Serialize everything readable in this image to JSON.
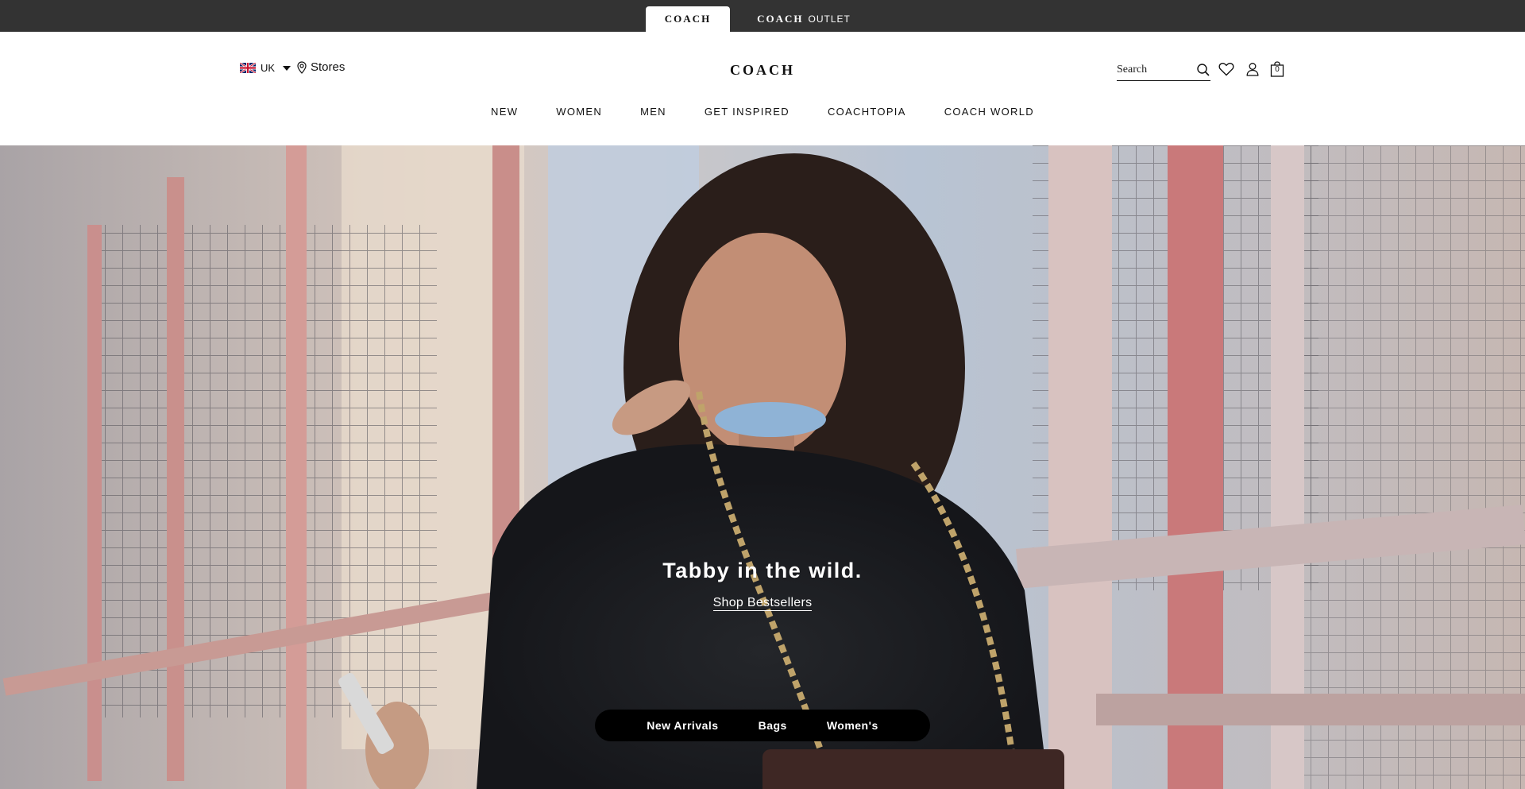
{
  "brandbar": {
    "tabs": [
      {
        "label": "COACH",
        "active": true
      },
      {
        "label": "COACH",
        "suffix": "OUTLET",
        "active": false
      }
    ],
    "background": "#333333"
  },
  "header": {
    "locale": {
      "label": "UK",
      "flag_icon": "uk-flag-icon"
    },
    "stores_label": "Stores",
    "logo": "COACH",
    "search": {
      "placeholder": "Search"
    },
    "icons": [
      "search-icon",
      "heart-icon",
      "account-icon",
      "bag-icon"
    ],
    "bag_count": "0"
  },
  "nav": {
    "items": [
      "NEW",
      "WOMEN",
      "MEN",
      "GET INSPIRED",
      "COACHTOPIA",
      "COACH WORLD"
    ]
  },
  "hero": {
    "title": "Tabby in the wild.",
    "link": "Shop Bestsellers",
    "quick_links": [
      "New Arrivals",
      "Bags",
      "Women's"
    ]
  }
}
